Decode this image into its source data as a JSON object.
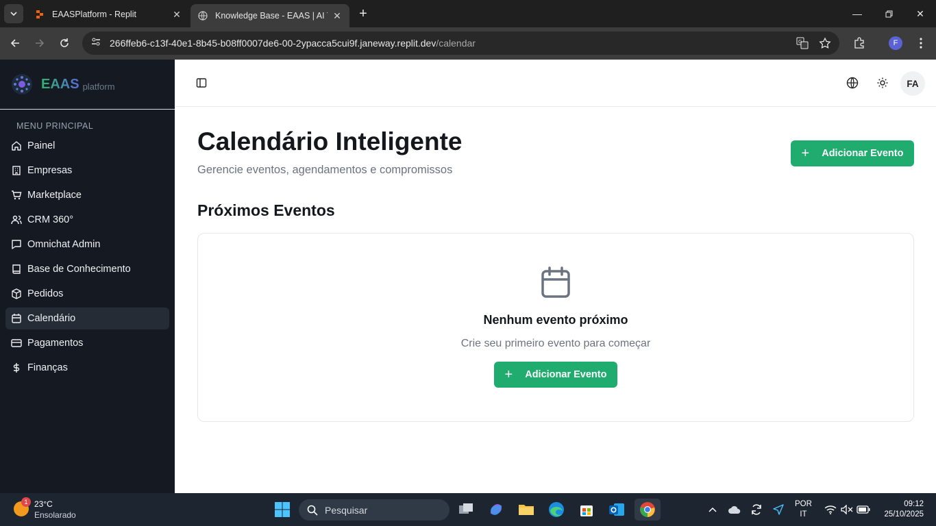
{
  "browser": {
    "tabs": [
      {
        "title": "EAASPlatform - Replit",
        "active": false
      },
      {
        "title": "Knowledge Base - EAAS | AI Tra",
        "active": true
      }
    ],
    "url_host": "266ffeb6-c13f-40e1-8b45-b08ff0007de6-00-2ypacca5cui9f.janeway.replit.dev",
    "url_path": "/calendar",
    "profile_initial": "F"
  },
  "sidebar": {
    "brand_name": "EAAS",
    "brand_sub": "platform",
    "menu_heading": "MENU PRINCIPAL",
    "items": [
      {
        "label": "Painel",
        "icon": "home-icon"
      },
      {
        "label": "Empresas",
        "icon": "building-icon"
      },
      {
        "label": "Marketplace",
        "icon": "cart-icon"
      },
      {
        "label": "CRM 360°",
        "icon": "users-icon"
      },
      {
        "label": "Omnichat Admin",
        "icon": "chat-icon"
      },
      {
        "label": "Base de Conhecimento",
        "icon": "book-icon"
      },
      {
        "label": "Pedidos",
        "icon": "package-icon"
      },
      {
        "label": "Calendário",
        "icon": "calendar-icon",
        "active": true
      },
      {
        "label": "Pagamentos",
        "icon": "credit-card-icon"
      },
      {
        "label": "Finanças",
        "icon": "dollar-icon"
      }
    ]
  },
  "header": {
    "avatar_initials": "FA"
  },
  "main": {
    "title": "Calendário Inteligente",
    "subtitle": "Gerencie eventos, agendamentos e compromissos",
    "add_event_label": "Adicionar Evento",
    "section_title": "Próximos Eventos",
    "empty_title": "Nenhum evento próximo",
    "empty_subtitle": "Crie seu primeiro evento para começar",
    "empty_button_label": "Adicionar Evento"
  },
  "taskbar": {
    "weather_badge": "1",
    "temperature": "23°C",
    "weather": "Ensolarado",
    "search_placeholder": "Pesquisar",
    "lang_line1": "POR",
    "lang_line2": "IT",
    "time": "09:12",
    "date": "25/10/2025"
  },
  "colors": {
    "accent_green": "#1fac6e",
    "sidebar_bg": "#151a22"
  }
}
